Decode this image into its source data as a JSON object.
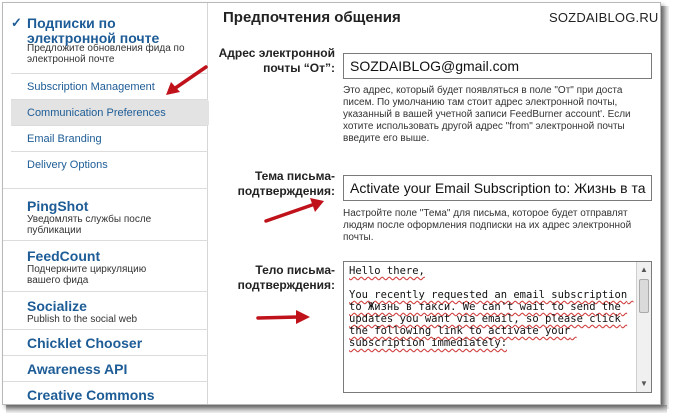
{
  "sidebar": {
    "email_section": {
      "check": "✓",
      "title": "Подписки по электронной почте",
      "desc": "Предложите обновления фида по электронной почте",
      "items": [
        {
          "label": "Subscription Management"
        },
        {
          "label": "Communication Preferences"
        },
        {
          "label": "Email Branding"
        },
        {
          "label": "Delivery Options"
        }
      ]
    },
    "services": [
      {
        "title": "PingShot",
        "desc": "Уведомлять службы после публикации"
      },
      {
        "title": "FeedCount",
        "desc": "Подчеркните циркуляцию вашего фида"
      },
      {
        "title": "Socialize",
        "desc": "Publish to the social web"
      },
      {
        "title": "Chicklet Chooser"
      },
      {
        "title": "Awareness API"
      },
      {
        "title": "Creative Commons"
      }
    ]
  },
  "main": {
    "heading": "Предпочтения общения",
    "watermark": "SOZDAIBLOG.RU",
    "from_field": {
      "label": "Адрес электронной почты “От”:",
      "value": "SOZDAIBLOG@gmail.com",
      "help": [
        "Это адрес, который будет появляться в поле \"От\" при доста",
        "писем. По умолчанию там стоит адрес электронной почты,",
        "указанный в вашей учетной записи FeedBurner account'. Если",
        "хотите использовать другой адрес \"from\" электронной почты",
        "введите его выше."
      ]
    },
    "subject_field": {
      "label": "Тема письма-подтверждения:",
      "value": "Activate your Email Subscription to: Жизнь в та",
      "help": [
        "Настройте поле \"Тема\" для письма, которое будет отправлят",
        "людям после оформления подписки на их адрес электронной",
        "почты."
      ]
    },
    "body_field": {
      "label": "Тело письма-подтверждения:",
      "value": "Hello there,\n\nYou recently requested an email subscription to Жизнь в такси. We can't wait to send the updates you want via email, so please click the following link to activate your subscription immediately:"
    }
  },
  "colors": {
    "accent": "#1d5c96",
    "arrow": "#c0121b",
    "active_bg": "#e3e3e3"
  }
}
